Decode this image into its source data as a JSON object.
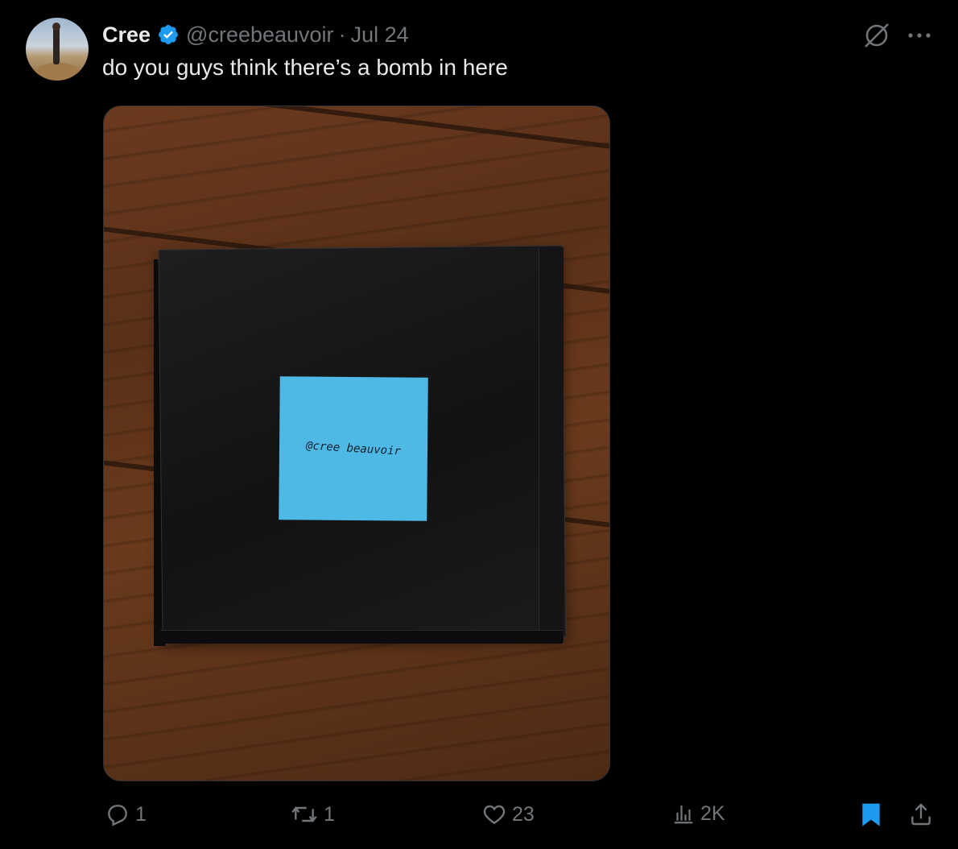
{
  "tweet": {
    "author_name": "Cree",
    "handle": "@creebeauvoir",
    "separator": "·",
    "date": "Jul 24",
    "text": "do you guys think there’s a bomb in here",
    "media_note_text": "@cree beauvoir"
  },
  "actions": {
    "reply_count": "1",
    "repost_count": "1",
    "like_count": "23",
    "view_count": "2K"
  },
  "icons": {
    "verified": "verified-badge-icon",
    "grok": "grok-icon",
    "more": "more-icon",
    "reply": "reply-icon",
    "repost": "repost-icon",
    "like": "heart-icon",
    "views": "views-icon",
    "bookmark": "bookmark-icon",
    "share": "share-icon"
  },
  "colors": {
    "accent": "#1d9bf0",
    "muted": "#71767b",
    "text": "#e7e9ea",
    "background": "#000000"
  }
}
